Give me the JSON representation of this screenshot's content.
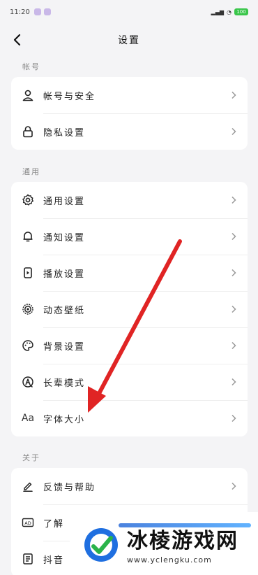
{
  "status": {
    "time": "11:20",
    "battery": "100"
  },
  "header": {
    "title": "设置"
  },
  "sections": {
    "account": {
      "label": "帐号",
      "items": [
        {
          "label": "帐号与安全",
          "icon": "user-icon"
        },
        {
          "label": "隐私设置",
          "icon": "lock-icon"
        }
      ]
    },
    "general": {
      "label": "通用",
      "items": [
        {
          "label": "通用设置",
          "icon": "gear-icon"
        },
        {
          "label": "通知设置",
          "icon": "bell-icon"
        },
        {
          "label": "播放设置",
          "icon": "play-icon"
        },
        {
          "label": "动态壁纸",
          "icon": "target-icon"
        },
        {
          "label": "背景设置",
          "icon": "palette-icon"
        },
        {
          "label": "长辈模式",
          "icon": "elder-icon"
        },
        {
          "label": "字体大小",
          "icon": "font-size-icon",
          "icon_text": "Aa"
        }
      ]
    },
    "about": {
      "label": "关于",
      "items": [
        {
          "label": "反馈与帮助",
          "icon": "edit-icon"
        },
        {
          "label": "了解",
          "icon": "ad-icon",
          "icon_text": "AD"
        },
        {
          "label": "抖音",
          "icon": "doc-icon"
        }
      ]
    }
  },
  "annotation": {
    "color": "#e02424"
  },
  "watermark": {
    "title": "冰棱游戏网",
    "url": "www.yclengku.com"
  }
}
